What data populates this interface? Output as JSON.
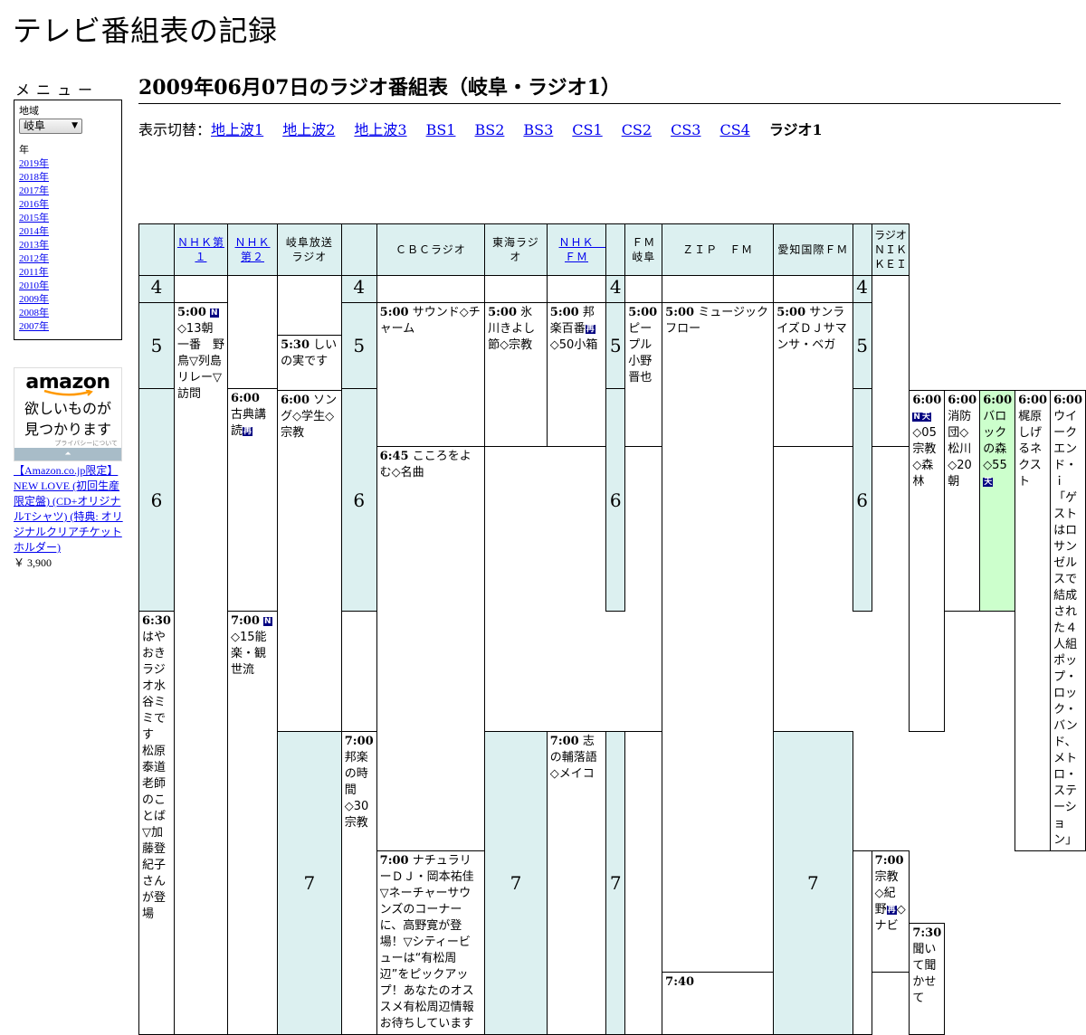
{
  "site": {
    "title": "テレビ番組表の記録"
  },
  "menu": {
    "label": "メニュー",
    "region_label": "地域",
    "region_selected": "岐阜",
    "year_label": "年",
    "years": [
      "2019年",
      "2018年",
      "2017年",
      "2016年",
      "2015年",
      "2014年",
      "2013年",
      "2012年",
      "2011年",
      "2010年",
      "2009年",
      "2008年",
      "2007年"
    ]
  },
  "ad": {
    "logo": "amazon",
    "copy_line1": "欲しいものが",
    "copy_line2": "見つかります",
    "privacy": "プライバシーについて",
    "arrow": "⏶",
    "product": "【Amazon.co.jp限定】NEW LOVE (初回生産限定盤) (CD+オリジナルTシャツ) (特典: オリジナルクリアチケットホルダー)",
    "price": "￥ 3,900"
  },
  "page": {
    "heading": "2009年06月07日のラジオ番組表（岐阜・ラジオ1）"
  },
  "switcher": {
    "label": "表示切替：",
    "links": [
      "地上波1",
      "地上波2",
      "地上波3",
      "BS1",
      "BS2",
      "BS3",
      "CS1",
      "CS2",
      "CS3",
      "CS4"
    ],
    "current": "ラジオ1"
  },
  "colors": {
    "header_bg": "#dcf0f0",
    "highlight_bg": "#ccffcc",
    "badge_bg": "#000080",
    "link": "#0000ee"
  },
  "badges": {
    "news": "N",
    "weather": "天",
    "re": "再"
  },
  "grid": {
    "hours": [
      "4",
      "5",
      "6",
      "7"
    ],
    "stations": [
      "ＮＨＫ第１",
      "ＮＨＫ第２",
      "岐阜放送ラジオ",
      "ＣＢＣラジオ",
      "東海ラジオ",
      "ＮＨＫ　ＦＭ",
      "ＦＭ岐阜",
      "ＺＩＰ　ＦＭ",
      "愛知国際ＦＭ",
      "ラジオＮＩＫＫＥＩ"
    ],
    "programs": {
      "nhk1_500": {
        "time": "5:00",
        "title": "◇13朝一番　野鳥▽列島リレー▽訪問"
      },
      "gbs_530": {
        "time": "5:30",
        "title": "しいの実です"
      },
      "cbc_500": {
        "time": "5:00",
        "title": "サウンド◇チャーム"
      },
      "tokai_500": {
        "time": "5:00",
        "title": "氷川きよし節◇宗教"
      },
      "nhkfm_500": {
        "time": "5:00",
        "title_a": "邦楽百番",
        "title_b": "◇50小箱"
      },
      "fmgifu_500": {
        "time": "5:00",
        "title": "ピープル小野晋也"
      },
      "zip_500": {
        "time": "5:00",
        "title": "ミュージックフロー"
      },
      "aichi_500": {
        "time": "5:00",
        "title": "サンライズＤＪサマンサ・ベガ"
      },
      "nhk2_600": {
        "time": "6:00",
        "title": "古典講読"
      },
      "gbs_600": {
        "time": "6:00",
        "title": "ソング◇学生◇宗教"
      },
      "cbc_600": {
        "time": "6:00",
        "title": "◇05宗教◇森林"
      },
      "tokai_600": {
        "time": "6:00",
        "title": "消防団◇松川◇20朝"
      },
      "nhkfm_600": {
        "time": "6:00",
        "title": "バロックの森◇55"
      },
      "fmgifu_600": {
        "time": "6:00",
        "title": "梶原しげるネクスト"
      },
      "aichi_600": {
        "time": "6:00",
        "title": "ウイークエンド・ｉ「ゲストはロサンゼルスで結成された４人組ポップ・ロック・バンド、メトロ・ステーション」"
      },
      "nhk2_645": {
        "time": "6:45",
        "title": "こころをよむ◇名曲"
      },
      "tokai_630": {
        "time": "6:30",
        "title": "はやおきラジオ水谷ミミです　松原泰道老師のことば▽加藤登紀子さんが登場"
      },
      "gbs_700": {
        "time": "7:00",
        "title": "邦楽の時間◇30宗教"
      },
      "cbc_700": {
        "time": "7:00",
        "title": "志の輔落語◇メイコ"
      },
      "nhkfm_700": {
        "time": "7:00",
        "title": "◇15能楽・観世流"
      },
      "zip_700": {
        "time": "7:00",
        "title": "ナチュラリーＤＪ・岡本祐佳▽ネーチャーサウンズのコーナーに、高野寛が登場！▽シティービューは“有松周辺”をピックアップ！あなたのオススメ有松周辺情報お待ちしています"
      },
      "nikkei_700": {
        "time": "7:00",
        "title_a": "宗教◇紀野",
        "title_b": "◇ナビ"
      },
      "nhk2_730": {
        "time": "7:30",
        "title": "聞いて聞かせて"
      },
      "nikkei_740": {
        "time": "7:40",
        "title": ""
      }
    }
  }
}
